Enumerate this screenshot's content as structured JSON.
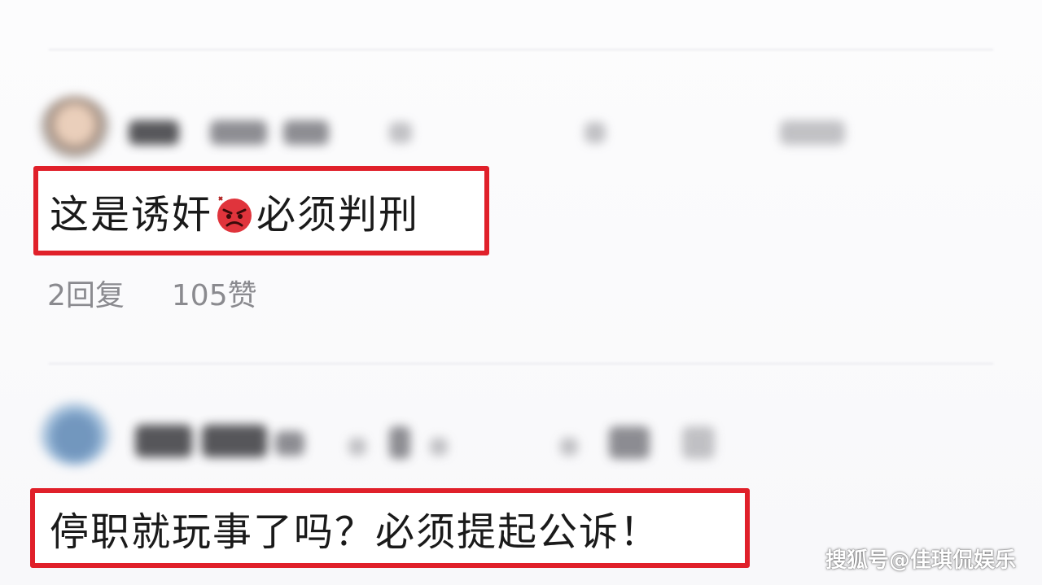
{
  "comments": [
    {
      "text_before_emoji": "这是诱奸",
      "emoji": "angry-face-icon",
      "text_after_emoji": "必须判刑",
      "reply_count_label": "2回复",
      "like_count_label": "105赞"
    },
    {
      "text": "停职就玩事了吗？必须提起公诉！"
    }
  ],
  "watermark": "搜狐号@佳琪侃娱乐",
  "colors": {
    "highlight_border": "#e0202a",
    "meta_text": "#8a8a8f"
  }
}
